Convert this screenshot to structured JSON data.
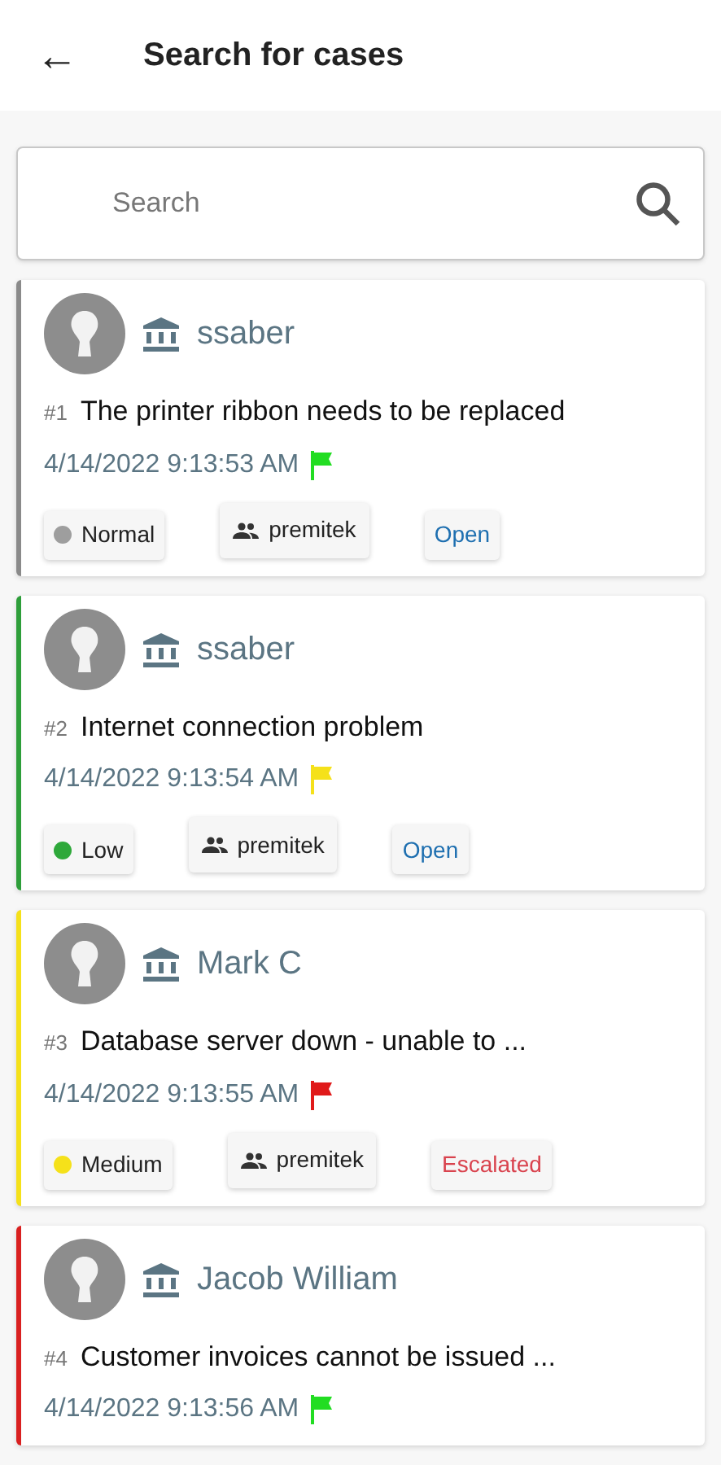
{
  "header": {
    "back": "←",
    "title": "Search for cases"
  },
  "search": {
    "placeholder": "Search"
  },
  "cases": [
    {
      "color": "#8a8a8a",
      "name": "ssaber",
      "number": "#1",
      "title": "The printer ribbon needs to be replaced",
      "date": "4/14/2022 9:13:53 AM",
      "flag": {
        "color": "#22dd22"
      },
      "priority": {
        "label": "Normal",
        "color": "#9e9e9e"
      },
      "team": "premitek",
      "status": {
        "label": "Open",
        "color": "#1e6fb0"
      }
    },
    {
      "color": "#2e9e3a",
      "name": "ssaber",
      "number": "#2",
      "title": "Internet connection problem",
      "date": "4/14/2022 9:13:54 AM",
      "flag": {
        "color": "#f5e11a"
      },
      "priority": {
        "label": "Low",
        "color": "#2ea83a"
      },
      "team": "premitek",
      "status": {
        "label": "Open",
        "color": "#1e6fb0"
      }
    },
    {
      "color": "#f5e11a",
      "name": "Mark C",
      "number": "#3",
      "title": "Database server down - unable to ...",
      "date": "4/14/2022 9:13:55 AM",
      "flag": {
        "color": "#e01a1a"
      },
      "priority": {
        "label": "Medium",
        "color": "#f5e11a"
      },
      "team": "premitek",
      "status": {
        "label": "Escalated",
        "color": "#d9434e"
      }
    },
    {
      "color": "#d92020",
      "name": "Jacob William",
      "number": "#4",
      "title": "Customer invoices cannot be issued ...",
      "date": "4/14/2022 9:13:56 AM",
      "flag": {
        "color": "#22dd22"
      }
    }
  ]
}
